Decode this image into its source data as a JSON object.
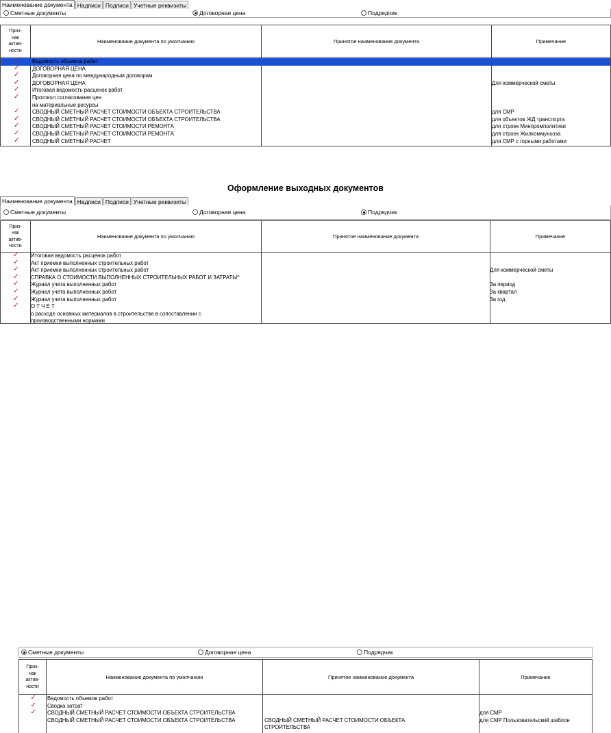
{
  "panel1": {
    "tabs": [
      "Наименование документа",
      "Надписи",
      "Подписи",
      "Учетные реквизиты"
    ],
    "radios": [
      {
        "label": "Сметные документы",
        "selected": false
      },
      {
        "label": "Договорная цена",
        "selected": true
      },
      {
        "label": "Подрядчик",
        "selected": false
      }
    ],
    "headers": [
      "Приз-\nнак\nактив-\nности",
      "Наименование документа по умолчанию",
      "Принятое наименование документа",
      "Примечание"
    ],
    "rows": [
      {
        "check": true,
        "name": "Ведомость объемов работ",
        "accepted": "",
        "note": "",
        "selected": true
      },
      {
        "check": true,
        "name": "ДОГОВОРНАЯ ЦЕНА",
        "accepted": "",
        "note": ""
      },
      {
        "check": true,
        "name": "Договорная цена по международным договорам",
        "accepted": "",
        "note": ""
      },
      {
        "check": true,
        "name": "ДОГОВОРНАЯ ЦЕНА",
        "accepted": "",
        "note": "Для коммерческой сметы"
      },
      {
        "check": true,
        "name": "Итоговая ведомость расценок работ",
        "accepted": "",
        "note": ""
      },
      {
        "check": true,
        "name": "Протокол согласования цен",
        "accepted": "",
        "note": ""
      },
      {
        "check": false,
        "name": "на материальные ресурсы",
        "accepted": "",
        "note": ""
      },
      {
        "check": true,
        "name": "СВОДНЫЙ СМЕТНЫЙ РАСЧЕТ СТОИМОСТИ ОБЪЕКТА СТРОИТЕЛЬСТВА",
        "accepted": "",
        "note": "для СМР"
      },
      {
        "check": true,
        "name": "СВОДНЫЙ СМЕТНЫЙ РАСЧЕТ СТОИМОСТИ ОБЪЕКТА СТРОИТЕЛЬСТВА",
        "accepted": "",
        "note": "для объектов ЖД транспорта"
      },
      {
        "check": true,
        "name": "СВОДНЫЙ СМЕТНЫЙ РАСЧЕТ СТОИМОСТИ РЕМОНТА",
        "accepted": "",
        "note": "для строек Минпромполитики"
      },
      {
        "check": true,
        "name": "СВОДНЫЙ СМЕТНЫЙ РАСЧЕТ СТОИМОСТИ РЕМОНТА",
        "accepted": "",
        "note": "для строек Жилкоммунхоза"
      },
      {
        "check": true,
        "name": "СВОДНЫЙ СМЕТНЫЙ РАСЧЕТ",
        "accepted": "",
        "note": "для СМР с горными работами"
      }
    ]
  },
  "heading": "Оформление выходных документов",
  "panel2": {
    "tabs": [
      "Наименование документа",
      "Надписи",
      "Подписи",
      "Учетные реквизиты"
    ],
    "radios": [
      {
        "label": "Сметные документы",
        "selected": false
      },
      {
        "label": "Договорная цена",
        "selected": false
      },
      {
        "label": "Подрядчик",
        "selected": true
      }
    ],
    "headers": [
      "Приз-\nнак\nактив-\nности",
      "Наименование документа по умолчанию",
      "Принятое наименование документа",
      "Примечание"
    ],
    "rows": [
      {
        "check": true,
        "name": "Итоговая ведомость расценок работ",
        "accepted": "",
        "note": ""
      },
      {
        "check": true,
        "name": "Акт приемки выполненных строительных работ",
        "accepted": "",
        "note": ""
      },
      {
        "check": true,
        "name": "Акт приемки выполненных строительных работ",
        "accepted": "",
        "note": "Для коммерческой сметы"
      },
      {
        "check": true,
        "name": "СПРАВКА О СТОИМОСТИ ВЫПОЛНЕННЫХ СТРОИТЕЛЬНЫХ РАБОТ И ЗАТРАТЫ^",
        "accepted": "",
        "note": ""
      },
      {
        "check": true,
        "name": "Журнал учета выполненных работ",
        "accepted": "",
        "note": "За период"
      },
      {
        "check": true,
        "name": "Журнал учета выполненных работ",
        "accepted": "",
        "note": "За квартал"
      },
      {
        "check": true,
        "name": "Журнал учета выполненных работ",
        "accepted": "",
        "note": "За год"
      },
      {
        "check": true,
        "name": "О Т Ч Е Т",
        "accepted": "",
        "note": ""
      },
      {
        "check": false,
        "name": "о расходе основных материалов в строительстве в сопоставлении с",
        "accepted": "",
        "note": ""
      },
      {
        "check": false,
        "name": "производственными нормами",
        "accepted": "",
        "note": ""
      }
    ]
  },
  "panel3": {
    "radios": [
      {
        "label": "Сметные документы",
        "selected": true
      },
      {
        "label": "Договорная цена",
        "selected": false
      },
      {
        "label": "Подрядчик",
        "selected": false
      }
    ],
    "headers": [
      "Приз-\nнак\nактив-\nности",
      "Наименование документа по умолчанию",
      "Принятое наименование документа",
      "Примечание"
    ],
    "rows": [
      {
        "check": true,
        "name": "Ведомость объемов работ",
        "accepted": "",
        "note": ""
      },
      {
        "check": true,
        "name": "Сводка затрат",
        "accepted": "",
        "note": ""
      },
      {
        "check": true,
        "name": "СВОДНЫЙ СМЕТНЫЙ РАСЧЕТ СТОИМОСТИ ОБЪЕКТА СТРОИТЕЛЬСТВА",
        "accepted": "",
        "note": "для СМР"
      },
      {
        "check": false,
        "name": "СВОДНЫЙ СМЕТНЫЙ РАСЧЕТ СТОИМОСТИ ОБЪЕКТА СТРОИТЕЛЬСТВА",
        "accepted": "СВОДНЫЙ СМЕТНЫЙ РАСЧЕТ СТОИМОСТИ ОБЪЕКТА",
        "note": "для СМР Пользовательский шаблон"
      },
      {
        "check": false,
        "name": "",
        "accepted": "СТРОИТЕЛЬСТВА",
        "note": ""
      }
    ]
  }
}
